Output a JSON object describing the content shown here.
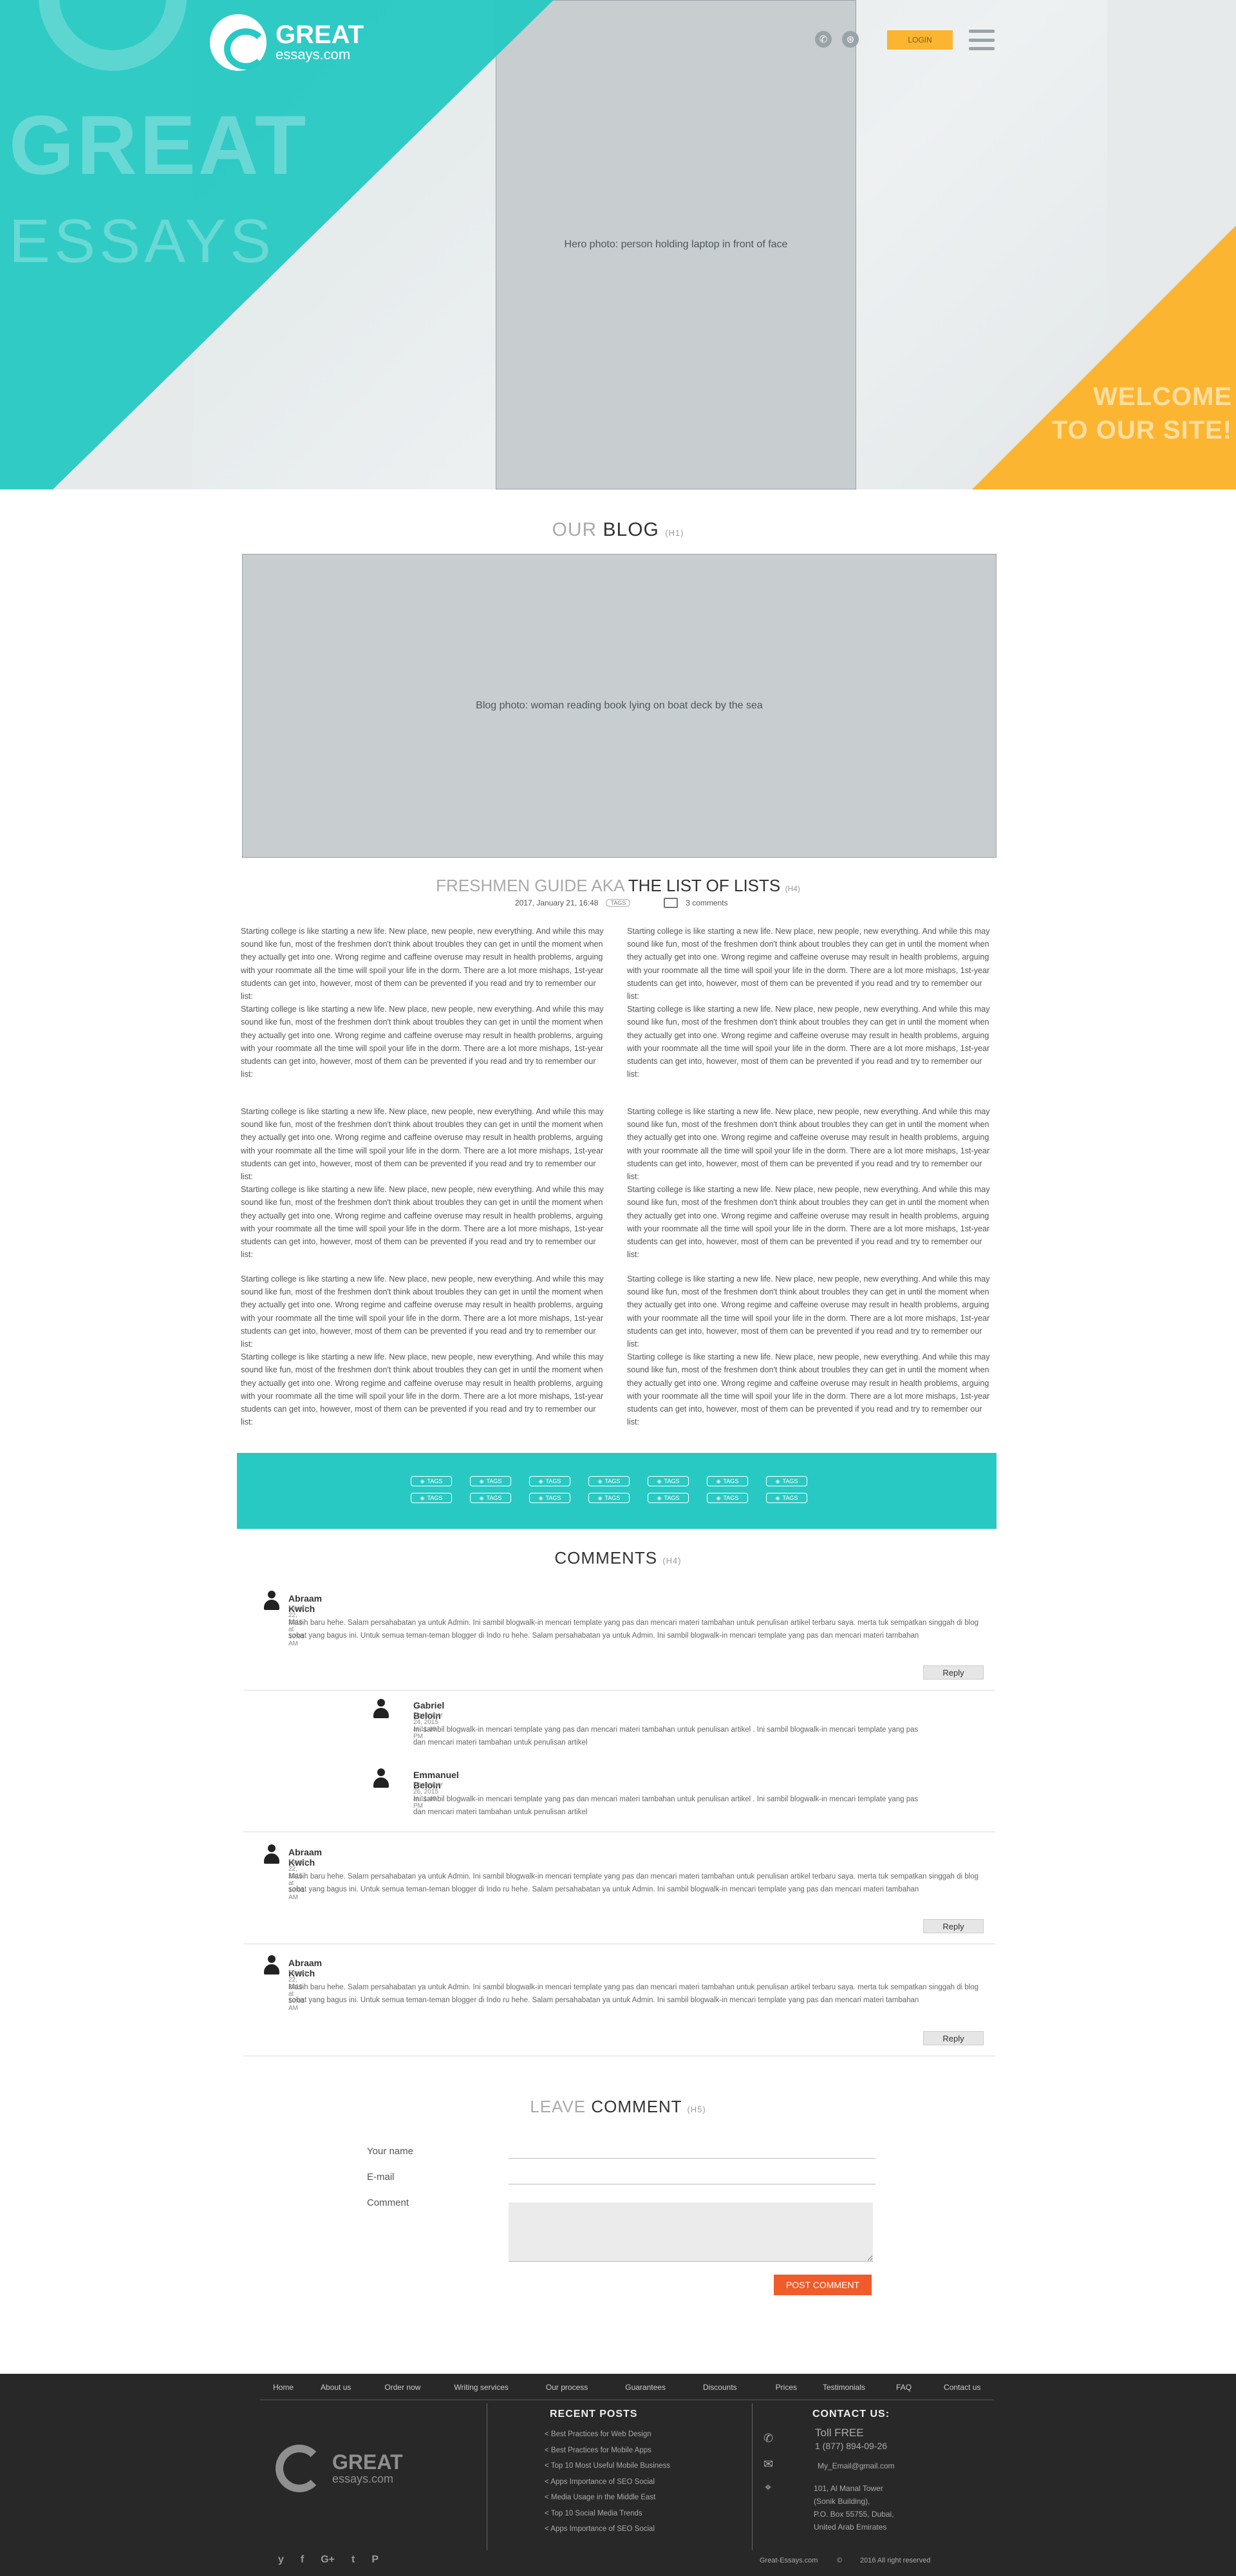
{
  "header": {
    "logo_great": "GREAT",
    "logo_site": "essays.com",
    "bg_text_great": "GREAT",
    "bg_text_essays": "ESSAYS",
    "login_label": "LOGIN",
    "welcome_line1": "WELCOME",
    "welcome_line2": "TO OUR SITE!",
    "hero_image_label": "Hero photo: person holding laptop in front of face"
  },
  "blog": {
    "title_light": "OUR",
    "title_bold": "BLOG",
    "title_tag": "(H1)",
    "image_label": "Blog photo: woman reading book lying on boat deck by the sea",
    "post_title_light": "FRESHMEN GUIDE AKA",
    "post_title_bold": "THE LIST OF LISTS",
    "post_title_tag": "(H4)",
    "post_date": "2017, January 21, 16:48",
    "post_tag": "TAGS",
    "post_comments": "3 comments",
    "paragraph": "Starting college is like starting a new life. New place, new people, new everything. And while this may sound like fun, most of the freshmen don't think about troubles they can get in until the moment when they actually get into one. Wrong regime and caffeine overuse may result in health problems, arguing with your roommate all the time will spoil your life in the dorm. There are a lot more mishaps, 1st-year students can get into, however, most of them can be prevented if you read and try to remember our list:"
  },
  "tags": [
    "TAGS",
    "TAGS",
    "TAGS",
    "TAGS",
    "TAGS",
    "TAGS",
    "TAGS",
    "TAGS",
    "TAGS",
    "TAGS",
    "TAGS",
    "TAGS",
    "TAGS",
    "TAGS"
  ],
  "comments": {
    "title": "COMMENTS",
    "title_tag": "(H4)",
    "reply_label": "Reply",
    "items": [
      {
        "name": "Abraam Kwich",
        "date": "March 22, 2015 at 10:01 AM",
        "body": "Masih baru hehe. Salam persahabatan ya untuk Admin. Ini sambil blogwalk-in mencari template yang pas dan mencari materi tambahan untuk penulisan artikel terbaru saya. merta tuk sempatkan singgah di blog sobat yang bagus ini. Untuk semua teman-teman blogger di Indo ru hehe. Salam persahabatan ya untuk Admin. Ini sambil blogwalk-in mencari template yang pas dan mencari materi tambahan"
      },
      {
        "name": "Gabriel Beloin",
        "date": "December 24, 2015 at 11:40 PM",
        "body": "Ini sambil blogwalk-in mencari template yang pas dan mencari materi tambahan untuk penulisan artikel . Ini sambil blogwalk-in mencari template yang pas dan mencari materi tambahan untuk penulisan artikel"
      },
      {
        "name": "Emmanuel Beloin",
        "date": "December 26, 2015 at 11:40 PM",
        "body": "Ini sambil blogwalk-in mencari template yang pas dan mencari materi tambahan untuk penulisan artikel . Ini sambil blogwalk-in mencari template yang pas dan mencari materi tambahan untuk penulisan artikel"
      },
      {
        "name": "Abraam Kwich",
        "date": "March 22, 2015 at 10:01 AM",
        "body": "Masih baru hehe. Salam persahabatan ya untuk Admin. Ini sambil blogwalk-in mencari template yang pas dan mencari materi tambahan untuk penulisan artikel terbaru saya. merta tuk sempatkan singgah di blog sobat yang bagus ini. Untuk semua teman-teman blogger di Indo ru hehe. Salam persahabatan ya untuk Admin. Ini sambil blogwalk-in mencari template yang pas dan mencari materi tambahan"
      },
      {
        "name": "Abraam Kwich",
        "date": "March 22, 2015 at 10:01 AM",
        "body": "Masih baru hehe. Salam persahabatan ya untuk Admin. Ini sambil blogwalk-in mencari template yang pas dan mencari materi tambahan untuk penulisan artikel terbaru saya. merta tuk sempatkan singgah di blog sobat yang bagus ini. Untuk semua teman-teman blogger di Indo ru hehe. Salam persahabatan ya untuk Admin. Ini sambil blogwalk-in mencari template yang pas dan mencari materi tambahan"
      }
    ]
  },
  "leave_comment": {
    "title_light": "LEAVE",
    "title_bold": "COMMENT",
    "title_tag": "(H5)",
    "name_label": "Your name",
    "email_label": "E-mail",
    "comment_label": "Comment",
    "submit_label": "POST COMMENT"
  },
  "footer": {
    "nav": [
      "Home",
      "About us",
      "Order now",
      "Writing services",
      "Our process",
      "Guarantees",
      "Discounts",
      "Prices",
      "Testimonials",
      "FAQ",
      "Contact us"
    ],
    "logo_great": "GREAT",
    "logo_site": "essays.com",
    "recent_title": "RECENT POSTS",
    "recent_posts": [
      "< Best Practices for Web Design",
      "< Best Practices for Mobile Apps",
      "< Top 10 Most Useful Mobile Business",
      "< Apps Importance of SEO Social",
      "< Media Usage in the Middle East",
      "< Top 10 Social Media Trends",
      "< Apps Importance of SEO Social"
    ],
    "contact_title": "CONTACT US:",
    "toll_free": "Toll FREE",
    "phone": "1 (877) 894-09-26",
    "email": "My_Email@gmail.com",
    "address": [
      "101, Al Manal Tower",
      "(Sonik Building),",
      "P.O. Box 55755, Dubai,",
      "United Arab Emirates"
    ],
    "social": [
      "y",
      "f",
      "G+",
      "t",
      "P"
    ],
    "site": "Great-Essays.com",
    "copyright": "2016 All right reserved"
  },
  "colors": {
    "teal": "#29c9c3",
    "yellow": "#fbb530",
    "orange": "#f15a29",
    "footer": "#282828"
  }
}
